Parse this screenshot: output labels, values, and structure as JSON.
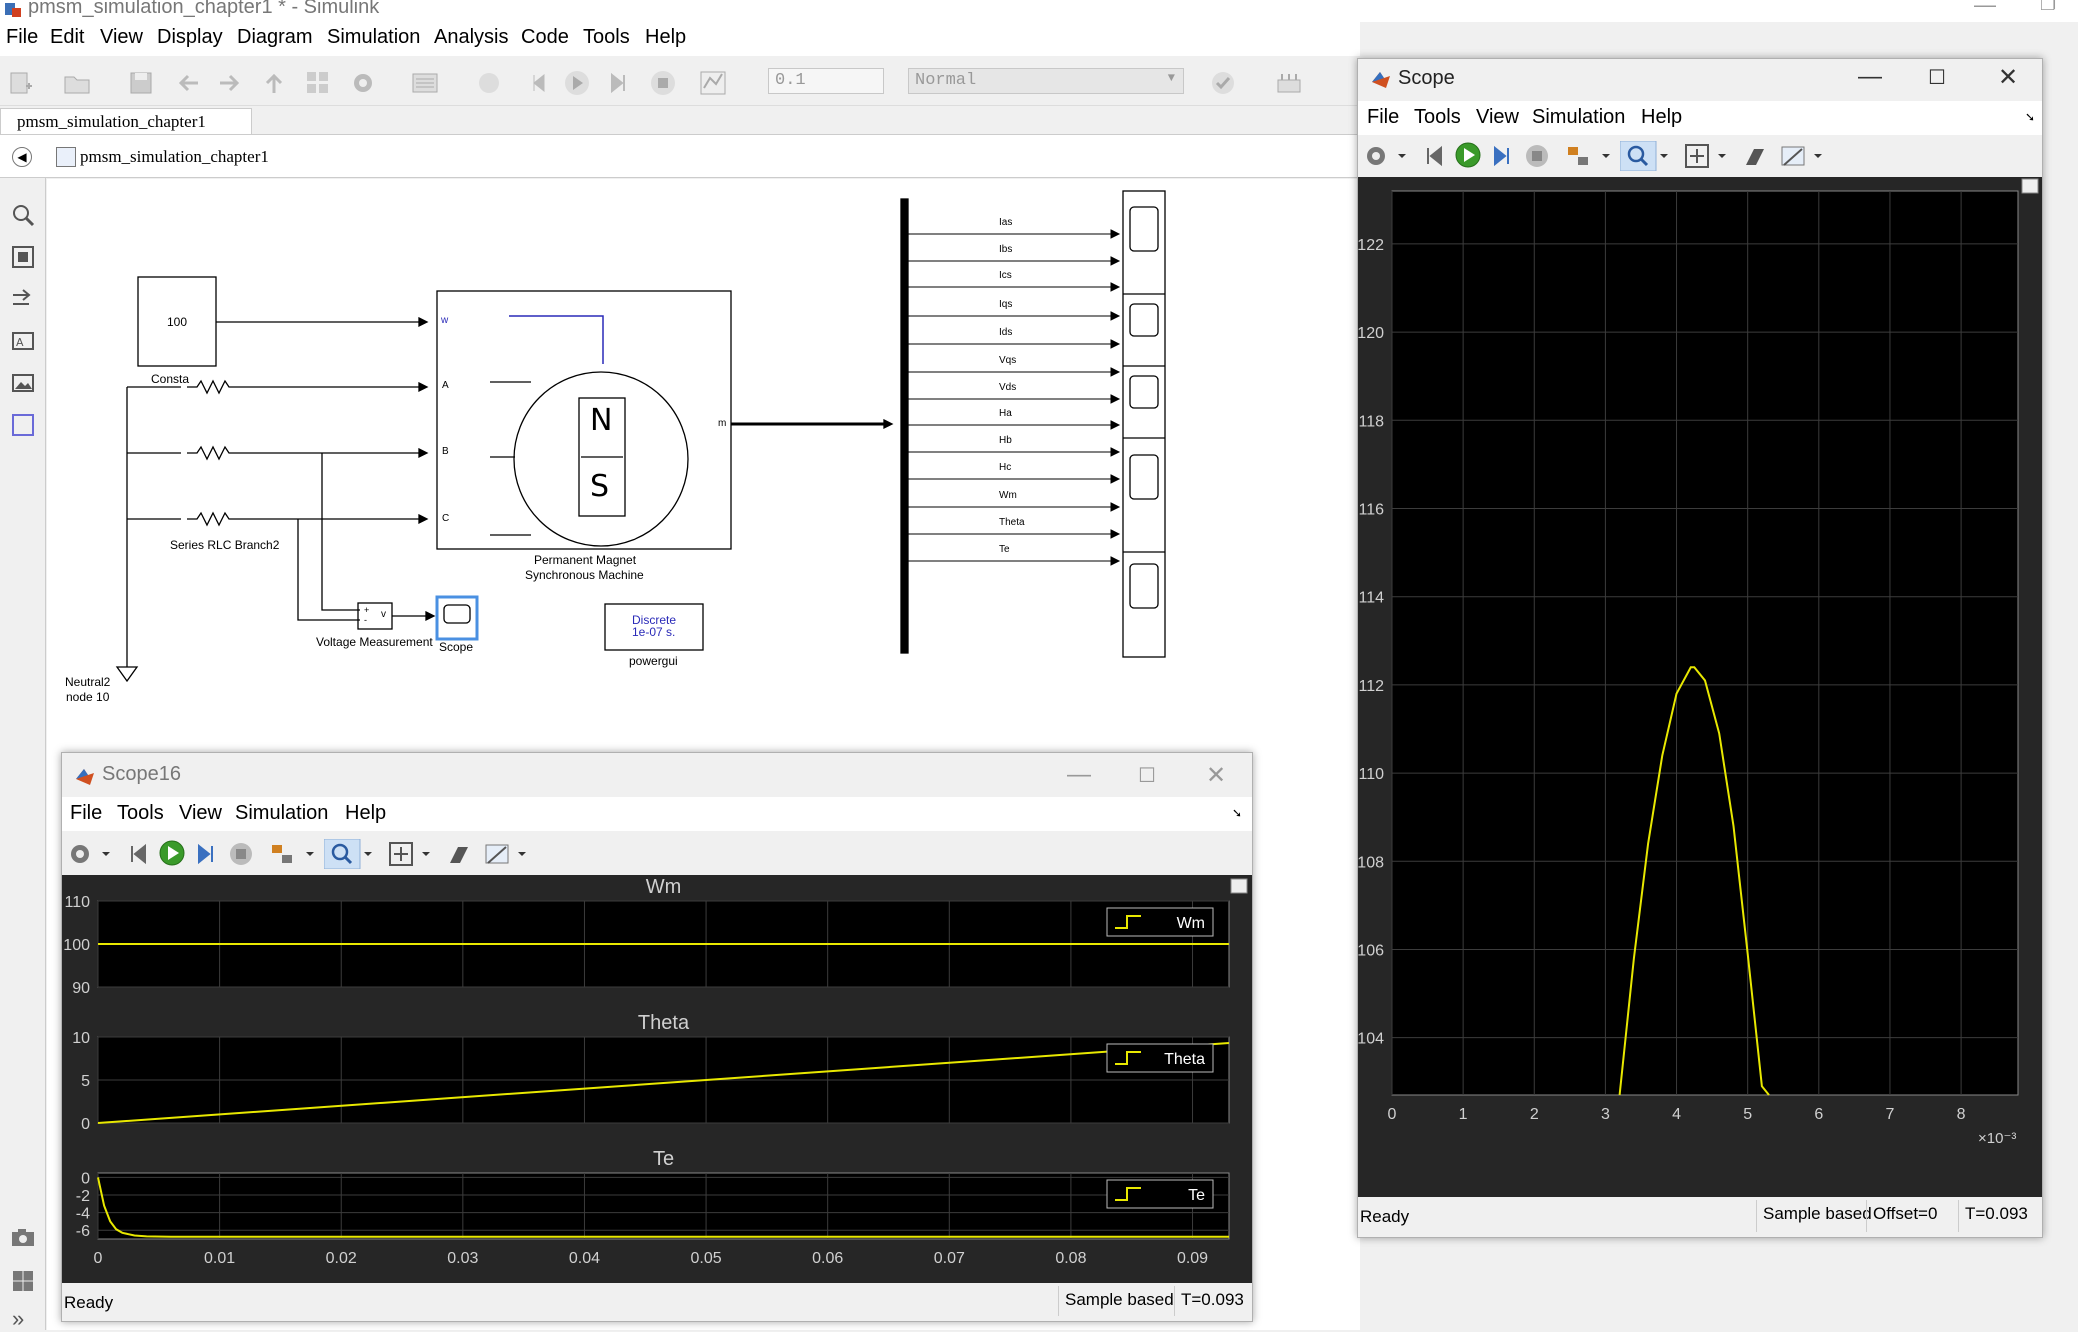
{
  "window": {
    "title": "pmsm_simulation_chapter1 * - Simulink"
  },
  "menu": [
    "File",
    "Edit",
    "View",
    "Display",
    "Diagram",
    "Simulation",
    "Analysis",
    "Code",
    "Tools",
    "Help"
  ],
  "toolbar": {
    "stop_time": "0.1",
    "sim_mode": "Normal"
  },
  "model_tab": "pmsm_simulation_chapter1",
  "breadcrumb": "pmsm_simulation_chapter1",
  "diagram": {
    "constant_value": "100",
    "constant_label": "Consta",
    "rlc_label": "Series RLC Branch2",
    "machine_label_1": "Permanent Magnet",
    "machine_label_2": "Synchronous Machine",
    "machine_port_w": "w",
    "machine_port_a": "A",
    "machine_port_b": "B",
    "machine_port_c": "C",
    "machine_port_m": "m",
    "machine_n": "N",
    "machine_s": "S",
    "vm_label": "Voltage Measurement",
    "vm_v": "v",
    "vm_plus": "+",
    "vm_minus": "-",
    "scope_label": "Scope",
    "powergui_line1": "Discrete",
    "powergui_line2": "1e-07 s.",
    "powergui_label": "powergui",
    "neutral_line1": "Neutral2",
    "neutral_line2": "node 10",
    "bus_signals": [
      "Ias",
      "Ibs",
      "Ics",
      "Iqs",
      "Ids",
      "Vqs",
      "Vds",
      "Ha",
      "Hb",
      "Hc",
      "Wm",
      "Theta",
      "Te"
    ]
  },
  "scope16": {
    "title": "Scope16",
    "menu": [
      "File",
      "Tools",
      "View",
      "Simulation",
      "Help"
    ],
    "status": "Ready",
    "sample": "Sample based",
    "time": "T=0.093"
  },
  "scope_main": {
    "title": "Scope",
    "menu": [
      "File",
      "Tools",
      "View",
      "Simulation",
      "Help"
    ],
    "status": "Ready",
    "sample": "Sample based",
    "offset": "Offset=0",
    "time": "T=0.093"
  },
  "colors": {
    "trace": "#e8e800",
    "plot_bg": "#000000",
    "scope_bg": "#262626",
    "grid": "#3c3c3c"
  },
  "chart_data": [
    {
      "type": "line",
      "title": "Wm",
      "xlim": [
        0,
        0.093
      ],
      "ylim": [
        90,
        110
      ],
      "yticks": [
        90,
        100,
        110
      ],
      "grid": true,
      "legend_position": "top-right",
      "series": [
        {
          "name": "Wm",
          "x": [
            0,
            0.093
          ],
          "y": [
            100,
            100
          ]
        }
      ]
    },
    {
      "type": "line",
      "title": "Theta",
      "xlim": [
        0,
        0.093
      ],
      "ylim": [
        0,
        10
      ],
      "yticks": [
        0,
        5,
        10
      ],
      "grid": true,
      "legend_position": "top-right",
      "series": [
        {
          "name": "Theta",
          "x": [
            0,
            0.093
          ],
          "y": [
            0,
            9.3
          ]
        }
      ]
    },
    {
      "type": "line",
      "title": "Te",
      "xlim": [
        0,
        0.093
      ],
      "ylim": [
        -7,
        0.5
      ],
      "yticks": [
        0,
        -2,
        -4,
        -6
      ],
      "xticks": [
        0,
        0.01,
        0.02,
        0.03,
        0.04,
        0.05,
        0.06,
        0.07,
        0.08,
        0.09
      ],
      "grid": true,
      "legend_position": "top-right",
      "series": [
        {
          "name": "Te",
          "x": [
            0,
            0.0005,
            0.001,
            0.0015,
            0.002,
            0.003,
            0.004,
            0.006,
            0.093
          ],
          "y": [
            0,
            -3.2,
            -5.0,
            -5.9,
            -6.3,
            -6.6,
            -6.7,
            -6.75,
            -6.75
          ]
        }
      ]
    },
    {
      "type": "line",
      "xlim": [
        0,
        8.8
      ],
      "ylim": [
        102.7,
        123.2
      ],
      "xticks": [
        0,
        1,
        2,
        3,
        4,
        5,
        6,
        7,
        8
      ],
      "yticks": [
        104,
        106,
        108,
        110,
        112,
        114,
        116,
        118,
        120,
        122
      ],
      "x_multiplier": "×10⁻³",
      "grid": true,
      "series": [
        {
          "name": "",
          "x": [
            3.2,
            3.4,
            3.6,
            3.8,
            4.0,
            4.2,
            4.25,
            4.4,
            4.6,
            4.8,
            5.0,
            5.2,
            5.3
          ],
          "y": [
            102.7,
            105.8,
            108.4,
            110.4,
            111.8,
            112.4,
            112.4,
            112.1,
            110.9,
            108.8,
            105.9,
            102.9,
            102.7
          ]
        }
      ]
    }
  ]
}
